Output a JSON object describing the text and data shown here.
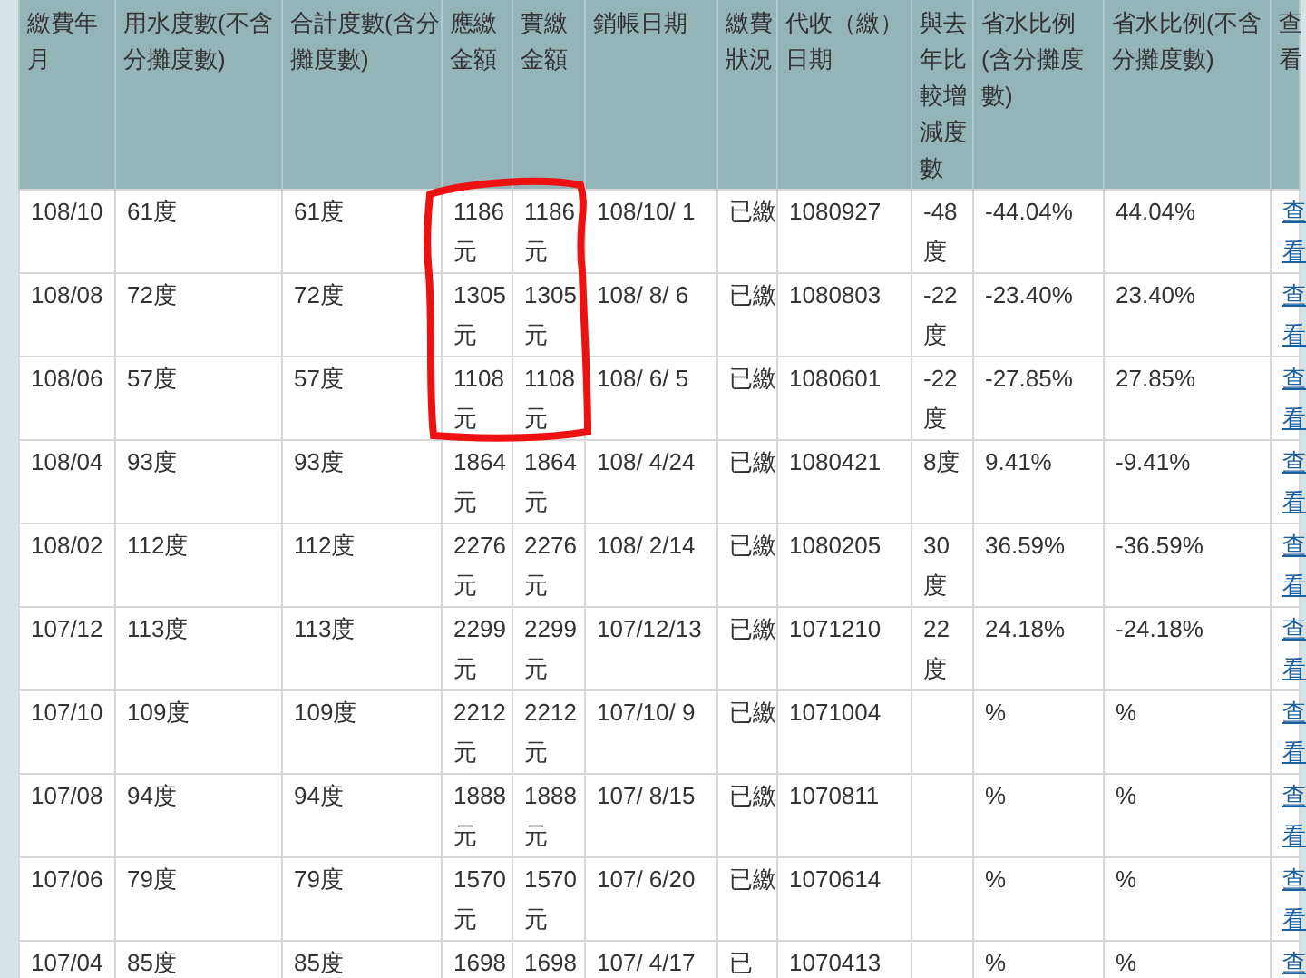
{
  "table": {
    "columns": [
      {
        "label": "繳費年月",
        "kind": "text"
      },
      {
        "label": "用水度數(不含分攤度數)",
        "kind": "text"
      },
      {
        "label": "合計度數(含分攤度數)",
        "kind": "text"
      },
      {
        "label": "應繳金額",
        "kind": "text"
      },
      {
        "label": "實繳金額",
        "kind": "text"
      },
      {
        "label": "銷帳日期",
        "kind": "text"
      },
      {
        "label": "繳費狀況",
        "kind": "text"
      },
      {
        "label": "代收（繳）日期",
        "kind": "text"
      },
      {
        "label": "與去年比較增減度數",
        "kind": "text"
      },
      {
        "label": "省水比例(含分攤度數)",
        "kind": "text"
      },
      {
        "label": "省水比例(不含分攤度數)",
        "kind": "text"
      },
      {
        "label": "查看",
        "kind": "link"
      }
    ],
    "rows": [
      {
        "cells": [
          "108/10",
          "61度",
          "61度",
          "1186元",
          "1186元",
          "108/10/ 1",
          "已繳",
          "1080927",
          "-48度",
          "-44.04%",
          "44.04%",
          "查看"
        ]
      },
      {
        "cells": [
          "108/08",
          "72度",
          "72度",
          "1305元",
          "1305元",
          "108/ 8/ 6",
          "已繳",
          "1080803",
          "-22度",
          "-23.40%",
          "23.40%",
          "查看"
        ]
      },
      {
        "cells": [
          "108/06",
          "57度",
          "57度",
          "1108元",
          "1108元",
          "108/ 6/ 5",
          "已繳",
          "1080601",
          "-22度",
          "-27.85%",
          "27.85%",
          "查看"
        ]
      },
      {
        "cells": [
          "108/04",
          "93度",
          "93度",
          "1864元",
          "1864元",
          "108/ 4/24",
          "已繳",
          "1080421",
          "8度",
          "9.41%",
          "-9.41%",
          "查看"
        ]
      },
      {
        "cells": [
          "108/02",
          "112度",
          "112度",
          "2276元",
          "2276元",
          "108/ 2/14",
          "已繳",
          "1080205",
          "30度",
          "36.59%",
          "-36.59%",
          "查看"
        ]
      },
      {
        "cells": [
          "107/12",
          "113度",
          "113度",
          "2299元",
          "2299元",
          "107/12/13",
          "已繳",
          "1071210",
          "22度",
          "24.18%",
          "-24.18%",
          "查看"
        ]
      },
      {
        "cells": [
          "107/10",
          "109度",
          "109度",
          "2212元",
          "2212元",
          "107/10/ 9",
          "已繳",
          "1071004",
          null,
          "%",
          "%",
          "查看"
        ]
      },
      {
        "cells": [
          "107/08",
          "94度",
          "94度",
          "1888元",
          "1888元",
          "107/ 8/15",
          "已繳",
          "1070811",
          null,
          "%",
          "%",
          "查看"
        ]
      },
      {
        "cells": [
          "107/06",
          "79度",
          "79度",
          "1570元",
          "1570元",
          "107/ 6/20",
          "已繳",
          "1070614",
          null,
          "%",
          "%",
          "查看"
        ]
      },
      {
        "cells": [
          "107/04",
          "85度",
          "85度",
          "1698",
          "1698",
          "107/ 4/17",
          "已",
          "1070413",
          null,
          "%",
          "%",
          "查"
        ]
      }
    ]
  }
}
